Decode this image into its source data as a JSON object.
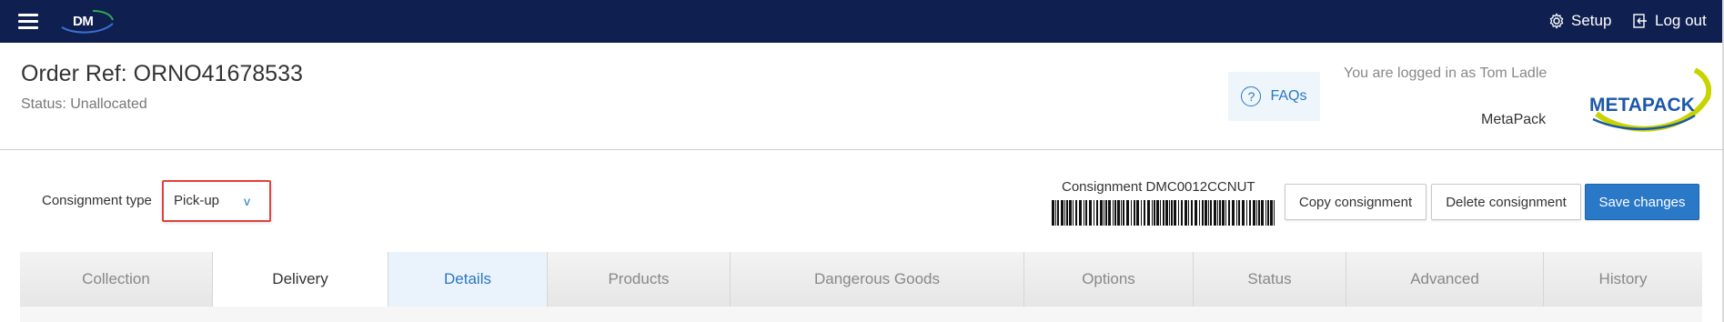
{
  "nav": {
    "logo_text": "DM",
    "setup_label": "Setup",
    "logout_label": "Log out"
  },
  "header": {
    "order_ref": "Order Ref: ORNO41678533",
    "status": "Status: Unallocated",
    "faqs_label": "FAQs",
    "logged_in": "You are logged in as Tom Ladle",
    "company": "MetaPack",
    "logo_text": "METAPACK"
  },
  "consignment": {
    "type_label": "Consignment type",
    "type_value": "Pick-up",
    "type_chevron": "v",
    "id_label": "Consignment DMC0012CCNUT"
  },
  "buttons": {
    "copy": "Copy consignment",
    "delete": "Delete consignment",
    "save": "Save changes"
  },
  "tabs": [
    {
      "label": "Collection"
    },
    {
      "label": "Delivery"
    },
    {
      "label": "Details"
    },
    {
      "label": "Products"
    },
    {
      "label": "Dangerous Goods"
    },
    {
      "label": "Options"
    },
    {
      "label": "Status"
    },
    {
      "label": "Advanced"
    },
    {
      "label": "History"
    }
  ],
  "colors": {
    "nav_bg": "#0f2050",
    "accent": "#2a78c8",
    "highlight_border": "#e0413e"
  }
}
